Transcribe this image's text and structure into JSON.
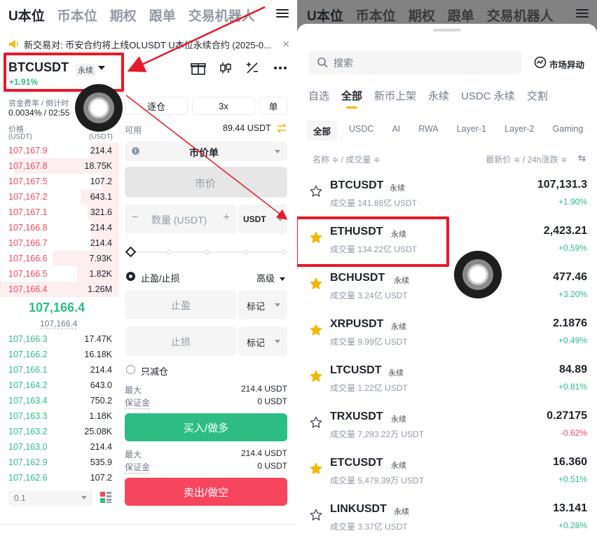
{
  "left": {
    "top_tabs": [
      "U本位",
      "币本位",
      "期权",
      "跟单",
      "交易机器人"
    ],
    "announcement": "新交易对: 币安合约将上线OLUSDT U本位永续合约 (2025-0...",
    "symbol": "BTCUSDT",
    "perp_label": "永续",
    "change": "+1.91%",
    "funding_label": "资金费率 / 倒计时",
    "funding_value": "0.0034% / 02:55",
    "price_col": "价格",
    "price_unit": "(USDT)",
    "qty_unit": "(USDT)",
    "asks": [
      {
        "p": "107,167.9",
        "q": "214.4"
      },
      {
        "p": "107,167.8",
        "q": "18.75K"
      },
      {
        "p": "107,167.5",
        "q": "107.2"
      },
      {
        "p": "107,167.2",
        "q": "643.1"
      },
      {
        "p": "107,167.1",
        "q": "321.6"
      },
      {
        "p": "107,166.8",
        "q": "214.4"
      },
      {
        "p": "107,166.7",
        "q": "214.4"
      },
      {
        "p": "107,166.6",
        "q": "7.93K"
      },
      {
        "p": "107,166.5",
        "q": "1.82K"
      },
      {
        "p": "107,166.4",
        "q": "1.26M"
      }
    ],
    "last_price": "107,166.4",
    "mark_price": "107,166.4",
    "bids": [
      {
        "p": "107,166.3",
        "q": "17.47K"
      },
      {
        "p": "107,166.2",
        "q": "16.18K"
      },
      {
        "p": "107,166.1",
        "q": "214.4"
      },
      {
        "p": "107,164.2",
        "q": "643.0"
      },
      {
        "p": "107,163.4",
        "q": "750.2"
      },
      {
        "p": "107,163.3",
        "q": "1.18K"
      },
      {
        "p": "107,163.2",
        "q": "25.08K"
      },
      {
        "p": "107,163.0",
        "q": "214.4"
      },
      {
        "p": "107,162.9",
        "q": "535.9"
      },
      {
        "p": "107,162.6",
        "q": "107.2"
      }
    ],
    "depth_step": "0.1",
    "margin_mode": "逐仓",
    "leverage": "3x",
    "order_side_mode": "单",
    "available_label": "可用",
    "available_value": "89.44 USDT",
    "order_type": "市价单",
    "price_placeholder": "市价",
    "qty_placeholder": "数量 (USDT)",
    "qty_unit_select": "USDT",
    "tpsl_label": "止盈/止损",
    "advanced_label": "高级",
    "tp_placeholder": "止盈",
    "sl_placeholder": "止损",
    "mark_label": "标记",
    "reduce_only": "只减仓",
    "max_label": "最大",
    "max_value_buy": "214.4 USDT",
    "margin_label": "保证金",
    "margin_value_buy": "0 USDT",
    "buy_label": "买入/做多",
    "max_value_sell": "214.4 USDT",
    "margin_value_sell": "0 USDT",
    "sell_label": "卖出/做空"
  },
  "right": {
    "search_placeholder": "搜索",
    "market_alert": "市场异动",
    "categories": [
      "自选",
      "全部",
      "新币上架",
      "永续",
      "USDC 永续",
      "交割"
    ],
    "chips": [
      "全部",
      "USDC",
      "AI",
      "RWA",
      "Layer-1",
      "Layer-2",
      "Gaming"
    ],
    "head_left": "名称 ≑ / 成交量 ≑",
    "head_right": "最新价 ≑ / 24h涨跌 ≑",
    "vol_prefix": "成交量",
    "rows": [
      {
        "sym": "BTCUSDT",
        "tag": "永续",
        "vol": "成交量 141.88亿 USDT",
        "price": "107,131.3",
        "chg": "+1.90%",
        "dir": "up",
        "fav": false
      },
      {
        "sym": "ETHUSDT",
        "tag": "永续",
        "vol": "成交量 134.22亿 USDT",
        "price": "2,423.21",
        "chg": "+0.59%",
        "dir": "up",
        "fav": true
      },
      {
        "sym": "BCHUSDT",
        "tag": "永续",
        "vol": "成交量 3.24亿 USDT",
        "price": "477.46",
        "chg": "+3.20%",
        "dir": "up",
        "fav": true
      },
      {
        "sym": "XRPUSDT",
        "tag": "永续",
        "vol": "成交量 9.99亿 USDT",
        "price": "2.1876",
        "chg": "+0.49%",
        "dir": "up",
        "fav": true
      },
      {
        "sym": "LTCUSDT",
        "tag": "永续",
        "vol": "成交量 1.22亿 USDT",
        "price": "84.89",
        "chg": "+0.81%",
        "dir": "up",
        "fav": true
      },
      {
        "sym": "TRXUSDT",
        "tag": "永续",
        "vol": "成交量 7,293.22万 USDT",
        "price": "0.27175",
        "chg": "-0.62%",
        "dir": "down",
        "fav": false
      },
      {
        "sym": "ETCUSDT",
        "tag": "永续",
        "vol": "成交量 5,479.39万 USDT",
        "price": "16.360",
        "chg": "+0.51%",
        "dir": "up",
        "fav": true
      },
      {
        "sym": "LINKUSDT",
        "tag": "永续",
        "vol": "成交量 3.37亿 USDT",
        "price": "13.141",
        "chg": "+0.28%",
        "dir": "up",
        "fav": false
      }
    ]
  },
  "colors": {
    "green": "#2ebd85",
    "red": "#f6465d",
    "annotation": "#e8182a",
    "star": "#f0b90b"
  }
}
